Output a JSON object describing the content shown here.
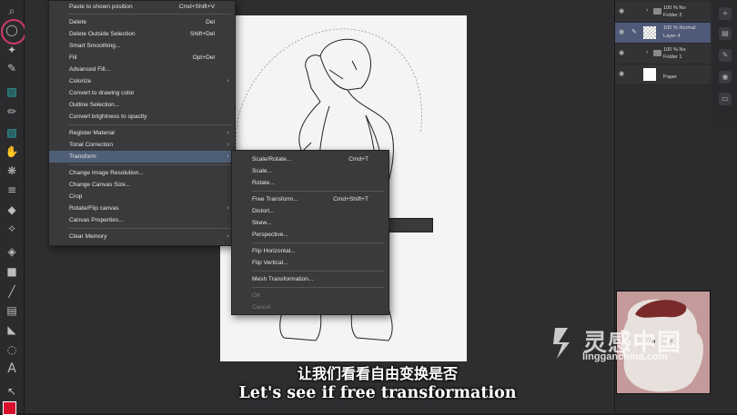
{
  "edit_menu": {
    "items": [
      {
        "label": "Paste to shown position",
        "shortcut": "Cmd+Shift+V"
      },
      {
        "label": "Delete",
        "shortcut": "Del"
      },
      {
        "label": "Delete Outside Selection",
        "shortcut": "Shift+Del"
      },
      {
        "label": "Smart Smoothing...",
        "shortcut": ""
      },
      {
        "label": "Fill",
        "shortcut": "Opt+Del"
      },
      {
        "label": "Advanced Fill...",
        "shortcut": ""
      },
      {
        "label": "Colorize",
        "shortcut": ""
      },
      {
        "label": "Convert to drawing color",
        "shortcut": ""
      },
      {
        "label": "Outline Selection...",
        "shortcut": ""
      },
      {
        "label": "Convert brightness to opacity",
        "shortcut": ""
      },
      {
        "label": "Register Material",
        "shortcut": ""
      },
      {
        "label": "Tonal Correction",
        "shortcut": ""
      },
      {
        "label": "Transform",
        "shortcut": ""
      },
      {
        "label": "Change Image Resolution...",
        "shortcut": ""
      },
      {
        "label": "Change Canvas Size...",
        "shortcut": ""
      },
      {
        "label": "Crop",
        "shortcut": ""
      },
      {
        "label": "Rotate/Flip canvas",
        "shortcut": ""
      },
      {
        "label": "Canvas Properties...",
        "shortcut": ""
      },
      {
        "label": "Clear Memory",
        "shortcut": ""
      }
    ]
  },
  "transform_menu": {
    "items": [
      {
        "label": "Scale/Rotate...",
        "shortcut": "Cmd+T"
      },
      {
        "label": "Scale...",
        "shortcut": ""
      },
      {
        "label": "Rotate...",
        "shortcut": ""
      },
      {
        "label": "Free Transform...",
        "shortcut": "Cmd+Shift+T"
      },
      {
        "label": "Distort...",
        "shortcut": ""
      },
      {
        "label": "Skew...",
        "shortcut": ""
      },
      {
        "label": "Perspective...",
        "shortcut": ""
      },
      {
        "label": "Flip Horizontal...",
        "shortcut": ""
      },
      {
        "label": "Flip Vertical...",
        "shortcut": ""
      },
      {
        "label": "Mesh Transformation...",
        "shortcut": ""
      },
      {
        "label": "OK",
        "shortcut": ""
      },
      {
        "label": "Cancel",
        "shortcut": ""
      }
    ]
  },
  "layers": [
    {
      "line1": "100 % No",
      "line2": "Folder 2"
    },
    {
      "line1": "100 % Normal",
      "line2": "Layer 4"
    },
    {
      "line1": "100 % No",
      "line2": "Folder 1"
    },
    {
      "line1": "",
      "line2": "Paper"
    }
  ],
  "subtitle": {
    "chinese": "让我们看看自由变换是否",
    "english": "Let's see if free transformation"
  },
  "watermark": {
    "name": "灵感中国",
    "url": "lingganchina.com"
  },
  "colors": {
    "highlight": "#4f5f78",
    "tool_ring": "#d23a6b",
    "menu_bg": "#3a3a3d"
  }
}
